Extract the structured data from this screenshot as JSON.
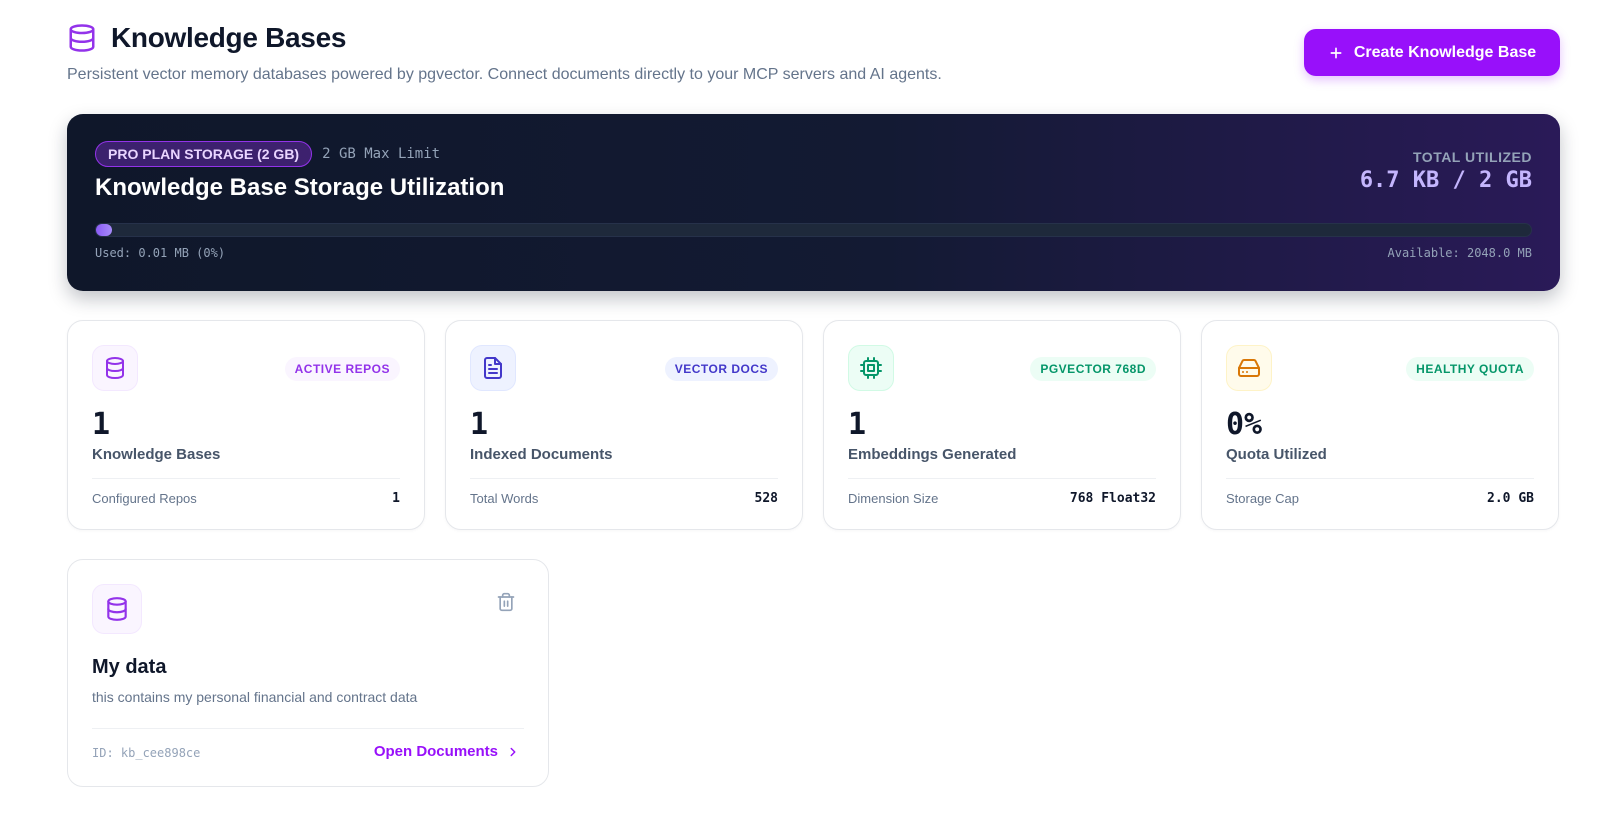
{
  "header": {
    "title": "Knowledge Bases",
    "subtitle": "Persistent vector memory databases powered by pgvector. Connect documents directly to your MCP servers and AI agents.",
    "create_label": "Create Knowledge Base",
    "title_icon": "database-icon",
    "create_icon": "plus-icon"
  },
  "storage": {
    "plan_badge": "PRO PLAN STORAGE (2 GB)",
    "plan_limit": "2 GB Max Limit",
    "title": "Knowledge Base Storage Utilization",
    "utilized_label": "TOTAL UTILIZED",
    "utilized_value": "6.7 KB / 2 GB",
    "used_text": "Used: 0.01 MB (0%)",
    "available_text": "Available: 2048.0 MB",
    "used_fraction": 0.0
  },
  "stats": [
    {
      "icon": "database-icon",
      "badge": "ACTIVE REPOS",
      "value": "1",
      "label": "Knowledge Bases",
      "foot_label": "Configured Repos",
      "foot_value": "1"
    },
    {
      "icon": "document-icon",
      "badge": "VECTOR DOCS",
      "value": "1",
      "label": "Indexed Documents",
      "foot_label": "Total Words",
      "foot_value": "528"
    },
    {
      "icon": "cpu-icon",
      "badge": "PGVECTOR 768D",
      "value": "1",
      "label": "Embeddings Generated",
      "foot_label": "Dimension Size",
      "foot_value": "768 Float32"
    },
    {
      "icon": "hard-drive-icon",
      "badge": "HEALTHY QUOTA",
      "value": "0%",
      "label": "Quota Utilized",
      "foot_label": "Storage Cap",
      "foot_value": "2.0 GB"
    }
  ],
  "knowledge_bases": [
    {
      "name": "My data",
      "description": "this contains my personal financial and contract data",
      "id_text": "ID: kb_cee898ce",
      "open_label": "Open Documents"
    }
  ],
  "colors": {
    "accent": "#9810fa",
    "purple_badge_bg": "#faf5ff",
    "purple_badge_fg": "#9333ea",
    "indigo_badge_bg": "#eef2ff",
    "indigo_badge_fg": "#4338ca",
    "green_badge_bg": "#ecfdf5",
    "green_badge_fg": "#059669",
    "amber_icon_bg": "#fffbeb",
    "amber_icon_fg": "#d97706"
  }
}
